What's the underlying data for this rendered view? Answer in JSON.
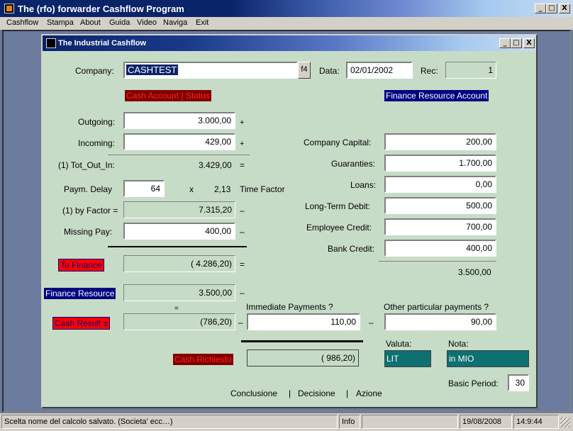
{
  "app": {
    "title": "The (rfo) forwarder Cashflow Program",
    "window_buttons": [
      "_",
      "□",
      "X"
    ]
  },
  "menu": [
    "Cashflow",
    "Stampa",
    "About",
    "Guida",
    "Video",
    "Naviga",
    "Exit"
  ],
  "child": {
    "title": "The Industrial Cashflow",
    "company_label": "Company:",
    "company_value": "CASHTEST",
    "f4_label": "f4",
    "data_label": "Data:",
    "data_value": "02/01/2002",
    "rec_label": "Rec:",
    "rec_value": "1",
    "cash_account_header": "Cash Account | Status",
    "finance_resource_header": "Finance Resource Account",
    "outgoing_label": "Outgoing:",
    "outgoing_value": "3.000,00",
    "incoming_label": "Incoming:",
    "incoming_value": "429,00",
    "plus_sign": "+",
    "tot_label": "(1) Tot_Out_In:",
    "tot_value": "3.429,00",
    "equals_sign": "=",
    "paym_delay_label": "Paym. Delay",
    "paym_delay_value": "64",
    "times_sign": "x",
    "factor_value": "2,13",
    "time_factor_label": "Time Factor",
    "by_factor_label": "(1) by Factor =",
    "by_factor_value": "7.315,20",
    "minus_sign": "–",
    "missing_pay_label": "Missing Pay:",
    "missing_pay_value": "400,00",
    "to_finance_label": "To Finance",
    "to_finance_value": "( 4.286,20)",
    "finance_resource_label": "Finance Resource",
    "finance_resource_value": "3.500,00",
    "cash_result_label": "Cash Result ±",
    "cash_result_value": "(786,20)",
    "immediate_label": "Immediate Payments ?",
    "immediate_value": "110,00",
    "other_label": "Other particular payments ?",
    "other_value": "90,00",
    "cash_richiesto_label": "Cash Richiesto",
    "cash_richiesto_value": "( 986,20)",
    "company_capital_label": "Company Capital:",
    "company_capital_value": "200,00",
    "guaranties_label": "Guaranties:",
    "guaranties_value": "1.700,00",
    "loans_label": "Loans:",
    "loans_value": "0,00",
    "long_term_label": "Long-Term Debit:",
    "long_term_value": "500,00",
    "employee_label": "Employee Credit:",
    "employee_value": "700,00",
    "bank_label": "Bank Credit:",
    "bank_value": "400,00",
    "resources_total": "3.500,00",
    "valuta_label": "Valuta:",
    "valuta_value": "LIT",
    "nota_label": "Nota:",
    "nota_value": "in MIO",
    "basic_period_label": "Basic Period:",
    "basic_period_value": "30",
    "nav_conclusione": "Conclusione",
    "nav_sep": "|",
    "nav_decisione": "Decisione",
    "nav_azione": "Azione"
  },
  "status": {
    "message": "Scelta nome del calcolo salvato. (Societa' ecc…)",
    "info": "Info",
    "date": "19/08/2008",
    "time": "14:9:44"
  },
  "colors": {
    "form_bg": "#c7dcc7",
    "title_blue": "#0a246a",
    "red_label": "#ff0000",
    "navy_label": "#000080",
    "teal_field": "#0e7070"
  }
}
